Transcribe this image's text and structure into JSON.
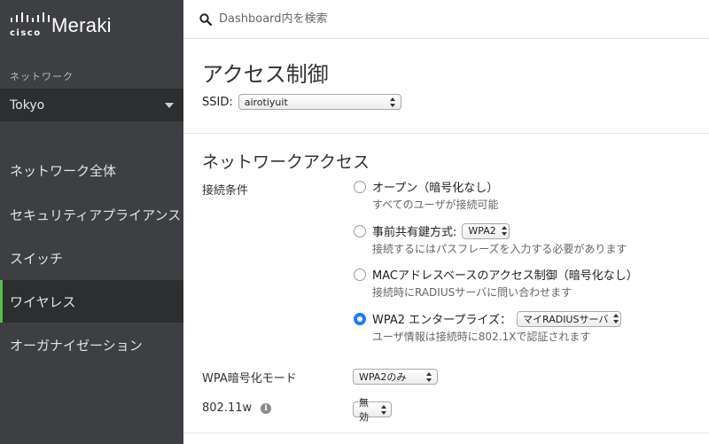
{
  "sidebar": {
    "logo_text": "cisco",
    "brand": "Meraki",
    "network_label": "ネットワーク",
    "network_selected": "Tokyo",
    "items": [
      {
        "label": "ネットワーク全体"
      },
      {
        "label": "セキュリティアプライアンス"
      },
      {
        "label": "スイッチ"
      },
      {
        "label": "ワイヤレス",
        "active": true
      },
      {
        "label": "オーガナイゼーション"
      }
    ],
    "accent_color": "#5bbc51"
  },
  "search": {
    "placeholder": "Dashboard内を検索",
    "icon": "search-icon"
  },
  "page": {
    "title": "アクセス制御",
    "ssid_label": "SSID:",
    "ssid_value": "airotiyuit"
  },
  "network_access": {
    "title": "ネットワークアクセス",
    "condition_label": "接続条件",
    "options": [
      {
        "main": "オープン（暗号化なし）",
        "sub": "すべてのユーザが接続可能",
        "checked": false
      },
      {
        "main": "事前共有鍵方式:",
        "select": "WPA2",
        "sub": "接続するにはパスフレーズを入力する必要があります",
        "checked": false
      },
      {
        "main": "MACアドレスベースのアクセス制御（暗号化なし）",
        "sub": "接続時にRADIUSサーバに問い合わせます",
        "checked": false
      },
      {
        "main": "WPA2 エンタープライズ：",
        "select": "マイRADIUSサーバ",
        "sub": "ユーザ情報は接続時に802.1Xで認証されます",
        "checked": true
      }
    ],
    "wpa_mode_label": "WPA暗号化モード",
    "wpa_mode_value": "WPA2のみ",
    "dot11w_label": "802.11w",
    "dot11w_value": "無効",
    "radio_color": "#1d7cf2"
  }
}
